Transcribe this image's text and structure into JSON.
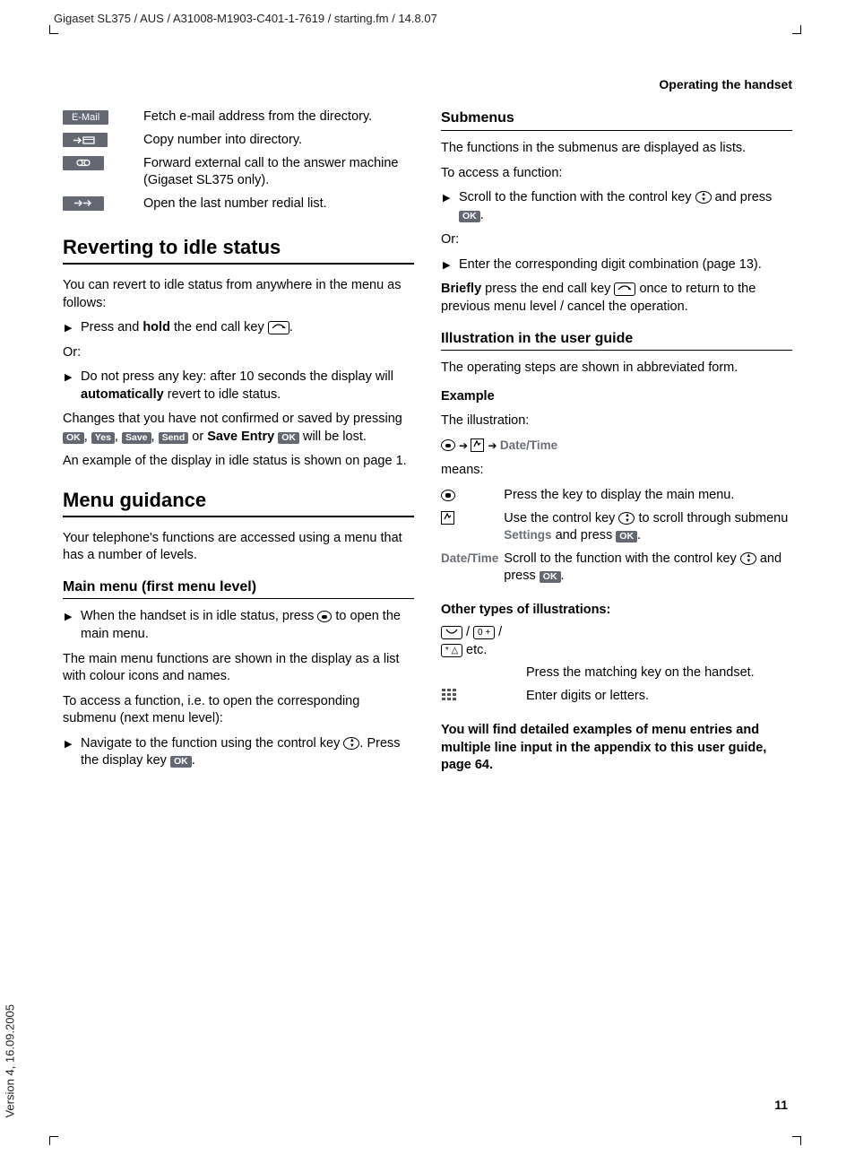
{
  "doc_header": "Gigaset SL375 / AUS / A31008-M1903-C401-1-7619 / starting.fm / 14.8.07",
  "running_head": "Operating the handset",
  "version_stamp": "Version 4, 16.09.2005",
  "page_number": "11",
  "left": {
    "defs": [
      {
        "icon": "E-Mail",
        "text": "Fetch e-mail address from the directory."
      },
      {
        "icon": "copy-to-dir",
        "text": "Copy number into directory."
      },
      {
        "icon": "answer-machine",
        "text": "Forward external call to the answer machine (Gigaset SL375 only)."
      },
      {
        "icon": "redial",
        "text": "Open the last number redial list."
      }
    ],
    "h1_revert": "Reverting to idle status",
    "revert_intro": "You can revert to idle status from anywhere in the menu as follows:",
    "revert_b1_pre": "Press and ",
    "revert_b1_bold": "hold",
    "revert_b1_post": " the end call key ",
    "or": "Or:",
    "revert_b2_a": "Do not press any key: after 10 seconds the display will ",
    "revert_b2_bold": "automatically",
    "revert_b2_b": " revert to idle status.",
    "revert_p2_a": "Changes that you have not confirmed or saved by pressing ",
    "revert_p2_b": " or ",
    "save_entry": "Save Entry",
    "revert_p2_c": " will be lost.",
    "btn_ok": "OK",
    "btn_yes": "Yes",
    "btn_save": "Save",
    "btn_send": "Send",
    "revert_p3": "An example of the display in idle status is shown on page 1.",
    "h1_menu": "Menu guidance",
    "menu_intro": "Your telephone's functions are accessed using a menu that has a number of levels.",
    "h2_main": "Main menu (first menu level)",
    "main_b1_a": "When the handset is in idle status, press ",
    "main_b1_b": " to open the main menu.",
    "main_p2": "The main menu functions are shown in the display as a list with colour icons and names.",
    "main_p3": "To access a function, i.e. to open the corresponding submenu (next menu level):",
    "main_b2_a": "Navigate to the function using the control key ",
    "main_b2_b": ". Press the display key "
  },
  "right": {
    "h2_sub": "Submenus",
    "sub_p1": "The functions in the submenus are displayed as lists.",
    "sub_p2": "To access a function:",
    "sub_b1_a": "Scroll to the function with the control key ",
    "sub_b1_b": " and press ",
    "or": "Or:",
    "sub_b2": "Enter the corresponding digit combination (page 13).",
    "briefly": "Briefly",
    "brief_p_a": " press the end call key ",
    "brief_p_b": " once to return to the previous menu level / cancel the operation.",
    "h2_illus": "Illustration in the user guide",
    "illus_p1": "The operating steps are shown in abbreviated form.",
    "h3_example": "Example",
    "illus_label": "The illustration:",
    "date_time": "Date/Time",
    "means": "means:",
    "tbl": [
      {
        "text": "Press the key to display the main menu."
      },
      {
        "text_a": "Use the control key ",
        "text_b": " to scroll through submenu ",
        "settings": "Settings",
        "text_c": " and press "
      },
      {
        "label": "Date/Time",
        "text_a": "Scroll to the function with the control key ",
        "text_b": " and press "
      }
    ],
    "h3_other": "Other types of illustrations:",
    "other_etc": " etc.",
    "other_r1": "Press the matching key on the handset.",
    "other_r2": "Enter digits or letters.",
    "footer_bold": "You will find detailed examples of menu entries and multiple line input in the appendix to this user guide, page 64."
  }
}
